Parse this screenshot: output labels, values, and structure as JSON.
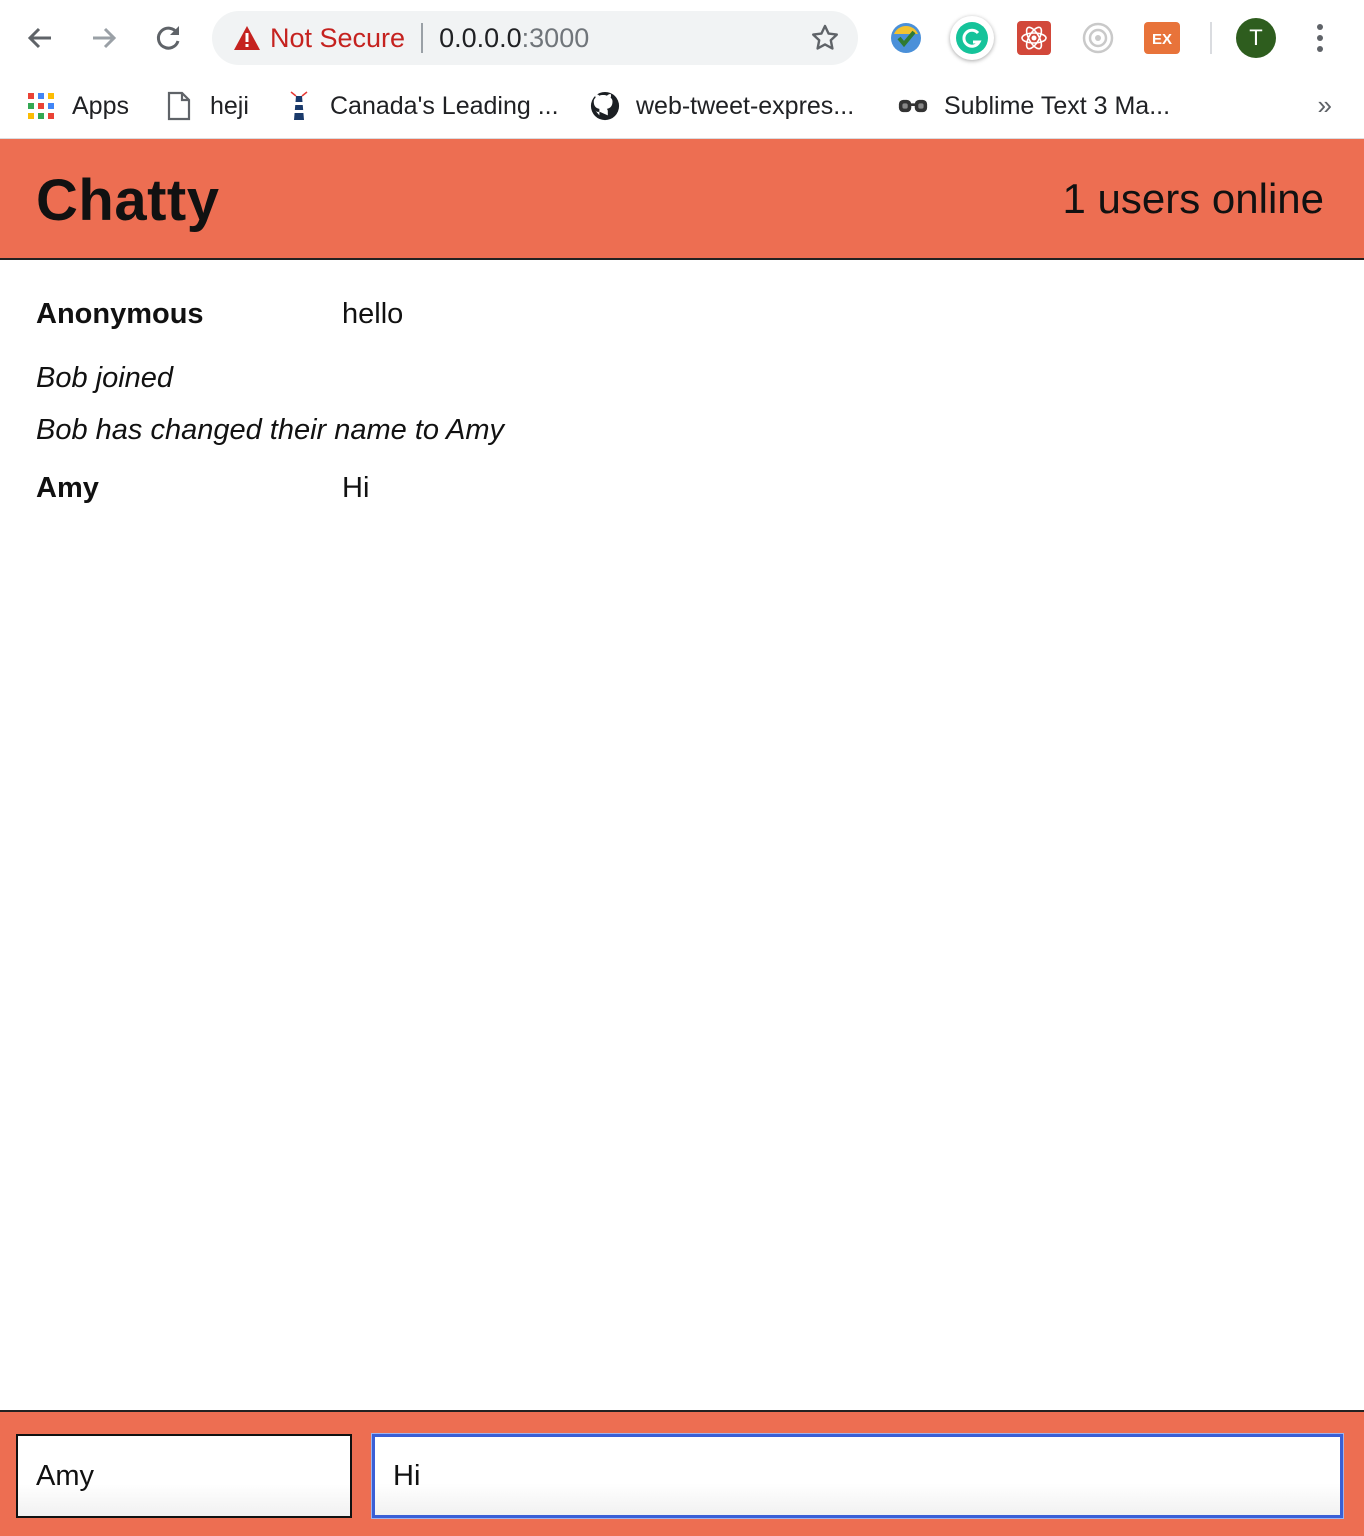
{
  "browser": {
    "security_label": "Not Secure",
    "url_host": "0.0.0.0",
    "url_port": ":3000",
    "profile_initial": "T",
    "bookmarks": [
      {
        "label": "Apps",
        "icon": "apps-grid-icon"
      },
      {
        "label": "heji",
        "icon": "document-icon"
      },
      {
        "label": "Canada's Leading ...",
        "icon": "lighthouse-icon"
      },
      {
        "label": "web-tweet-expres...",
        "icon": "github-icon"
      },
      {
        "label": "Sublime Text 3 Ma...",
        "icon": "glasses-icon"
      }
    ],
    "bookmarks_overflow": "»"
  },
  "app": {
    "brand": "Chatty",
    "online_count_text": "1 users online",
    "accent_color": "#ed6e52",
    "messages": [
      {
        "type": "message",
        "username": "Anonymous",
        "content": "hello"
      },
      {
        "type": "notification",
        "content": "Bob joined"
      },
      {
        "type": "notification",
        "content": "Bob has changed their name to Amy"
      },
      {
        "type": "message",
        "username": "Amy",
        "content": "Hi"
      }
    ],
    "chatbar": {
      "username_value": "Amy",
      "message_value": "Hi"
    }
  }
}
